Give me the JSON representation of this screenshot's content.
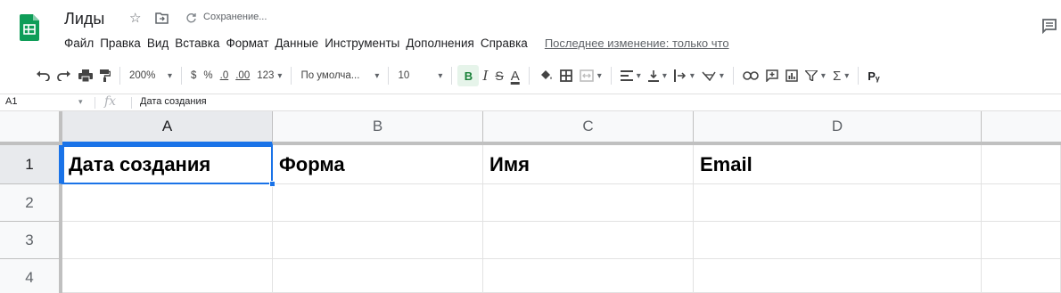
{
  "app": {
    "doc_title": "Лиды",
    "save_status": "Сохранение...",
    "icons": [
      "sheets-logo-icon",
      "star-icon",
      "move-to-folder-icon",
      "sync-icon",
      "comments-icon"
    ],
    "colors": {
      "brand_green": "#0f9d58",
      "selection_blue": "#1a73e8",
      "bold_active_bg": "#e6f4ea"
    }
  },
  "menu": {
    "items": [
      "Файл",
      "Правка",
      "Вид",
      "Вставка",
      "Формат",
      "Данные",
      "Инструменты",
      "Дополнения",
      "Справка"
    ],
    "last_edit": "Последнее изменение: только что"
  },
  "toolbar": {
    "zoom": "200%",
    "currency": "$",
    "percent": "%",
    "decrease_decimals": ".0",
    "increase_decimals": ".00",
    "more_formats": "123",
    "font": "По умолча...",
    "font_size": "10",
    "bold": "B",
    "italic": "I",
    "strikethrough": "S",
    "text_color": "A",
    "functions": "Σ"
  },
  "formula_bar": {
    "name_box": "A1",
    "fx": "fx",
    "content": "Дата создания"
  },
  "sheet": {
    "columns": [
      "A",
      "B",
      "C",
      "D"
    ],
    "rows": [
      "1",
      "2",
      "3",
      "4"
    ],
    "cells": [
      [
        "Дата создания",
        "Форма",
        "Имя",
        "Email"
      ],
      [
        "",
        "",
        "",
        ""
      ],
      [
        "",
        "",
        "",
        ""
      ],
      [
        "",
        "",
        "",
        ""
      ]
    ],
    "active_cell": "A1"
  }
}
